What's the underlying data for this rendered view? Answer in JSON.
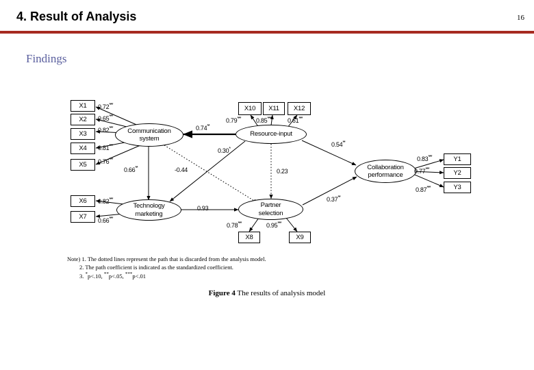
{
  "slide": {
    "title": "4. Result of Analysis",
    "page_number": "16",
    "rule_color": "#a62a20",
    "section_heading": "Findings",
    "section_heading_color": "#5a5f9e"
  },
  "figure": {
    "caption_label": "Figure 4",
    "caption_text": " The results of analysis model"
  },
  "notes": {
    "line1": "Note) 1. The dotted lines represent the path that is discarded from the analysis model.",
    "line2": "2. The path coefficient is indicated as the standardized coefficient.",
    "line3_prefix": "3. ",
    "line3_a_star": "*",
    "line3_a": "p<.10, ",
    "line3_b_star": "**",
    "line3_b": "p<.05, ",
    "line3_c_star": "***",
    "line3_c": "p<.01"
  },
  "chart_data": {
    "type": "diagram",
    "title": "Figure 4 The results of analysis model",
    "diagram_kind": "structural-equation-model-path-diagram",
    "latent_variables": [
      {
        "id": "communication_system",
        "label": "Communication\nsystem",
        "label_line1": "Communication",
        "label_line2": "system"
      },
      {
        "id": "resource_input",
        "label": "Resource-input",
        "label_line1": "Resource-input",
        "label_line2": ""
      },
      {
        "id": "technology_marketing",
        "label": "Technology\nmarketing",
        "label_line1": "Technology",
        "label_line2": "marketing"
      },
      {
        "id": "partner_selection",
        "label": "Partner\nselection",
        "label_line1": "Partner",
        "label_line2": "selection"
      },
      {
        "id": "collaboration_performance",
        "label": "Collaboration\nperformance",
        "label_line1": "Collaboration",
        "label_line2": "performance"
      }
    ],
    "observed_variables": [
      {
        "id": "x1",
        "label": "X1"
      },
      {
        "id": "x2",
        "label": "X2"
      },
      {
        "id": "x3",
        "label": "X3"
      },
      {
        "id": "x4",
        "label": "X4"
      },
      {
        "id": "x5",
        "label": "X5"
      },
      {
        "id": "x6",
        "label": "X6"
      },
      {
        "id": "x7",
        "label": "X7"
      },
      {
        "id": "x8",
        "label": "X8"
      },
      {
        "id": "x9",
        "label": "X9"
      },
      {
        "id": "x10",
        "label": "X10"
      },
      {
        "id": "x11",
        "label": "X11"
      },
      {
        "id": "x12",
        "label": "X12"
      },
      {
        "id": "y1",
        "label": "Y1"
      },
      {
        "id": "y2",
        "label": "Y2"
      },
      {
        "id": "y3",
        "label": "Y3"
      }
    ],
    "measurement_paths": [
      {
        "from": "communication_system",
        "to": "x1",
        "value": "0.72",
        "stars": "***",
        "line": "solid"
      },
      {
        "from": "communication_system",
        "to": "x2",
        "value": "0.65",
        "stars": "***",
        "line": "solid"
      },
      {
        "from": "communication_system",
        "to": "x3",
        "value": "0.82",
        "stars": "***",
        "line": "solid"
      },
      {
        "from": "communication_system",
        "to": "x4",
        "value": "0.81",
        "stars": "***",
        "line": "solid"
      },
      {
        "from": "communication_system",
        "to": "x5",
        "value": "0.76",
        "stars": "***",
        "line": "solid"
      },
      {
        "from": "technology_marketing",
        "to": "x6",
        "value": "0.82",
        "stars": "***",
        "line": "solid"
      },
      {
        "from": "technology_marketing",
        "to": "x7",
        "value": "0.66",
        "stars": "***",
        "line": "solid"
      },
      {
        "from": "partner_selection",
        "to": "x8",
        "value": "0.78",
        "stars": "***",
        "line": "solid"
      },
      {
        "from": "partner_selection",
        "to": "x9",
        "value": "0.95",
        "stars": "***",
        "line": "solid"
      },
      {
        "from": "resource_input",
        "to": "x10",
        "value": "0.79",
        "stars": "***",
        "line": "solid"
      },
      {
        "from": "resource_input",
        "to": "x11",
        "value": "0.85",
        "stars": "***",
        "line": "solid"
      },
      {
        "from": "resource_input",
        "to": "x12",
        "value": "0.61",
        "stars": "***",
        "line": "solid"
      },
      {
        "from": "collaboration_performance",
        "to": "y1",
        "value": "0.83",
        "stars": "***",
        "line": "solid"
      },
      {
        "from": "collaboration_performance",
        "to": "y2",
        "value": "0.77",
        "stars": "***",
        "line": "solid"
      },
      {
        "from": "collaboration_performance",
        "to": "y3",
        "value": "0.87",
        "stars": "***",
        "line": "solid"
      }
    ],
    "structural_paths": [
      {
        "from": "resource_input",
        "to": "communication_system",
        "value": "0.74",
        "stars": "**",
        "line": "solid"
      },
      {
        "from": "resource_input",
        "to": "technology_marketing",
        "value": "0.30",
        "stars": "*",
        "line": "solid"
      },
      {
        "from": "resource_input",
        "to": "partner_selection",
        "value": "0.23",
        "stars": "",
        "line": "dotted"
      },
      {
        "from": "communication_system",
        "to": "technology_marketing",
        "value": "0.66",
        "stars": "**",
        "line": "solid"
      },
      {
        "from": "communication_system",
        "to": "partner_selection",
        "value": "-0.44",
        "stars": "",
        "line": "dotted"
      },
      {
        "from": "technology_marketing",
        "to": "partner_selection",
        "value": "0.93",
        "stars": "",
        "line": "solid"
      },
      {
        "from": "resource_input",
        "to": "collaboration_performance",
        "value": "0.54",
        "stars": "**",
        "line": "solid"
      },
      {
        "from": "partner_selection",
        "to": "collaboration_performance",
        "value": "0.37",
        "stars": "**",
        "line": "solid"
      }
    ],
    "coefficient_labels": {
      "x1": "0.72",
      "x1_stars": "***",
      "x2": "0.65",
      "x2_stars": "***",
      "x3": "0.82",
      "x3_stars": "***",
      "x4": "0.81",
      "x4_stars": "***",
      "x5": "0.76",
      "x5_stars": "***",
      "x6": "0.82",
      "x6_stars": "***",
      "x7": "0.66",
      "x7_stars": "***",
      "x8": "0.78",
      "x8_stars": "***",
      "x9": "0.95",
      "x9_stars": "***",
      "x10": "0.79",
      "x10_stars": "***",
      "x11": "0.85",
      "x11_stars": "***",
      "x12": "0.61",
      "x12_stars": "***",
      "y1": "0.83",
      "y1_stars": "***",
      "y2": "0.77",
      "y2_stars": "***",
      "y3": "0.87",
      "y3_stars": "***",
      "ri_cs": "0.74",
      "ri_cs_stars": "**",
      "ri_tm": "0.30",
      "ri_tm_stars": "*",
      "ri_ps": "0.23",
      "ri_ps_stars": "",
      "cs_tm": "0.66",
      "cs_tm_stars": "**",
      "cs_ps": "-0.44",
      "cs_ps_stars": "",
      "tm_ps": "0.93",
      "tm_ps_stars": "",
      "ri_cp": "0.54",
      "ri_cp_stars": "**",
      "ps_cp": "0.37",
      "ps_cp_stars": "**"
    }
  }
}
